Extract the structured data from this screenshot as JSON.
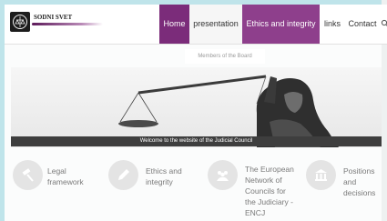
{
  "site": {
    "logo_text": "SODNI SVET"
  },
  "nav": {
    "items": [
      {
        "label": "Home"
      },
      {
        "label": "presentation"
      },
      {
        "label": "Ethics and integrity"
      },
      {
        "label": "links"
      },
      {
        "label": "Contact"
      }
    ],
    "dropdown_item": "Members of the Board"
  },
  "hero": {
    "caption": "Welcome to the website of the Judicial Council"
  },
  "features": [
    {
      "label": "Legal\nframework",
      "icon": "gavel-icon"
    },
    {
      "label": "Ethics and\nintegrity",
      "icon": "pen-icon"
    },
    {
      "label": "The European\nNetwork of\nCouncils for\nthe Judiciary -\nENCJ",
      "icon": "people-icon"
    },
    {
      "label": "Positions and\ndecisions",
      "icon": "building-icon"
    }
  ],
  "colors": {
    "brand_purple": "#7b2c7a",
    "nav_hover": "#8e3f8c",
    "caption_bar": "#3e3e3e"
  }
}
